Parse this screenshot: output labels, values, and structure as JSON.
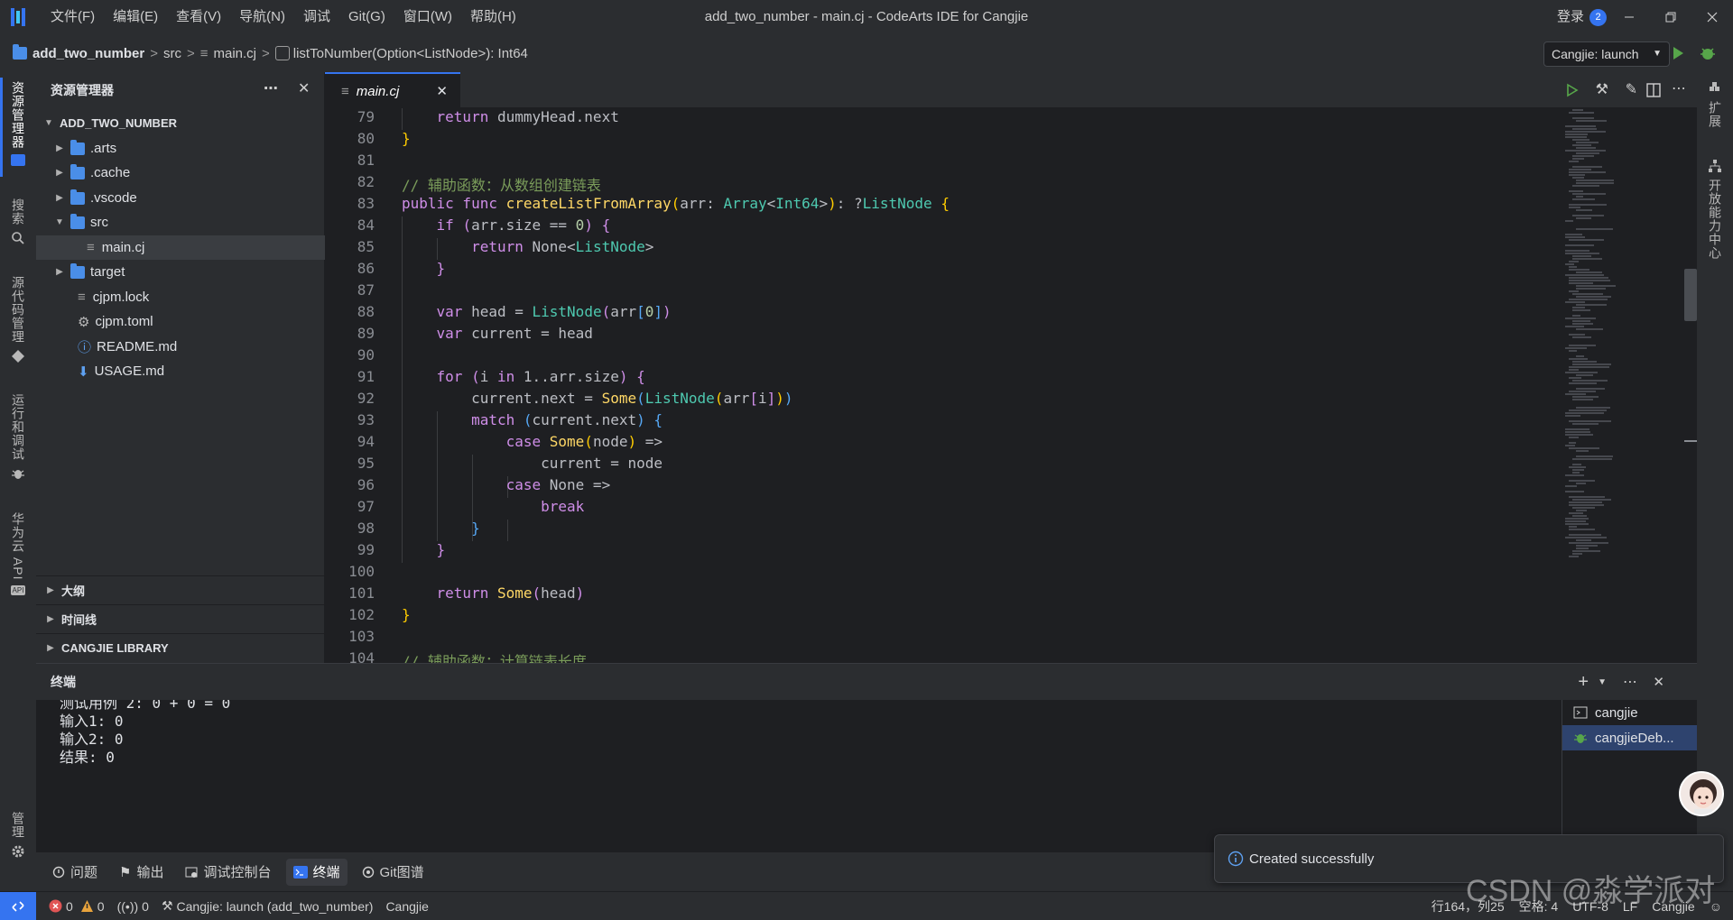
{
  "titlebar": {
    "menus": [
      "文件(F)",
      "编辑(E)",
      "查看(V)",
      "导航(N)",
      "调试",
      "Git(G)",
      "窗口(W)",
      "帮助(H)"
    ],
    "window_title": "add_two_number - main.cj - CodeArts IDE for Cangjie",
    "login": "登录",
    "notification_count": "2"
  },
  "breadcrumb": {
    "project": "add_two_number",
    "folder": "src",
    "file": "main.cj",
    "symbol": "listToNumber(Option<ListNode>): Int64",
    "run_config": "Cangjie: launch"
  },
  "activity": {
    "explorer": "资源管理器",
    "search": "搜索",
    "scm": "源代码管理",
    "run": "运行和调试",
    "api": "华为云 API",
    "manage": "管理"
  },
  "rightbar": {
    "extensions": "扩展",
    "open_center": "开放能力中心"
  },
  "explorer": {
    "title": "资源管理器",
    "root": "ADD_TWO_NUMBER",
    "items": [
      {
        "label": ".arts",
        "type": "folder",
        "icon": "arts-folder-icon"
      },
      {
        "label": ".cache",
        "type": "folder",
        "icon": "folder-icon"
      },
      {
        "label": ".vscode",
        "type": "folder",
        "icon": "folder-icon"
      },
      {
        "label": "src",
        "type": "folder-open",
        "icon": "src-folder-icon"
      },
      {
        "label": "main.cj",
        "type": "file",
        "icon": "file-lines-icon"
      },
      {
        "label": "target",
        "type": "folder",
        "icon": "target-folder-icon"
      },
      {
        "label": "cjpm.lock",
        "type": "file",
        "icon": "file-lines-icon"
      },
      {
        "label": "cjpm.toml",
        "type": "file",
        "icon": "gear-icon"
      },
      {
        "label": "README.md",
        "type": "file",
        "icon": "info-icon"
      },
      {
        "label": "USAGE.md",
        "type": "file",
        "icon": "download-icon"
      }
    ],
    "sections": [
      "大纲",
      "时间线",
      "CANGJIE LIBRARY"
    ]
  },
  "editor": {
    "tab": "main.cj",
    "line_numbers": [
      "79",
      "80",
      "81",
      "82",
      "83",
      "84",
      "85",
      "86",
      "87",
      "88",
      "89",
      "90",
      "91",
      "92",
      "93",
      "94",
      "95",
      "96",
      "97",
      "98",
      "99",
      "100",
      "101",
      "102",
      "103",
      "104"
    ],
    "code": {
      "l79_return": "return",
      "l79_rest": "dummyHead.next",
      "l80": "}",
      "l82": "// 辅助函数：从数组创建链表",
      "l83_kw": "public func",
      "l83_fn": "createListFromArray",
      "l83_param": "arr",
      "l83_type": "Array",
      "l83_type2": "Int64",
      "l83_ret": "ListNode",
      "l84_if": "if",
      "l84_cond": "arr.size == ",
      "l84_num": "0",
      "l85_return": "return",
      "l85_none": "None",
      "l85_type": "ListNode",
      "l86": "}",
      "l88_var": "var",
      "l88_name": "head = ",
      "l88_ctor": "ListNode",
      "l88_arg": "arr",
      "l88_idx": "0",
      "l89_var": "var",
      "l89_name": "current = head",
      "l91_for": "for",
      "l91_i": "i",
      "l91_in": "in",
      "l91_range": "1..arr.size",
      "l92_lhs": "current.next = ",
      "l92_some": "Some",
      "l92_ctor": "ListNode",
      "l92_arg": "arr",
      "l92_idx": "i",
      "l93_match": "match",
      "l93_expr": "current.next",
      "l94_case": "case",
      "l94_some": "Some",
      "l94_node": "node",
      "l95": "current = node",
      "l96_case": "case",
      "l96_none": "None",
      "l97": "break",
      "l98": "}",
      "l99": "}",
      "l101_return": "return",
      "l101_some": "Some",
      "l101_arg": "head",
      "l102": "}",
      "l104": "// 辅助函数：计算链表长度"
    }
  },
  "terminal": {
    "title": "终端",
    "lines": [
      "测试用例 2: 0 + 0 = 0",
      "输入1: 0",
      "输入2: 0",
      "结果: 0"
    ],
    "sessions": [
      "cangjie",
      "cangjieDeb..."
    ]
  },
  "toolbar": {
    "tabs": [
      "问题",
      "输出",
      "调试控制台",
      "终端",
      "Git图谱"
    ]
  },
  "statusbar": {
    "errors": "0",
    "warnings": "0",
    "ports": "0",
    "launch": "Cangjie: launch (add_two_number)",
    "lang_mode": "Cangjie",
    "position": "行164，列25",
    "spaces": "空格: 4",
    "encoding": "UTF-8",
    "eol": "LF",
    "language": "Cangjie"
  },
  "toast": {
    "message": "Created successfully"
  },
  "watermark": "CSDN @淼学派对",
  "colors": {
    "accent": "#3574f0",
    "keyword": "#cf8ee8",
    "function": "#ffd866",
    "type": "#4ec9b0",
    "comment": "#7a9c5a"
  }
}
